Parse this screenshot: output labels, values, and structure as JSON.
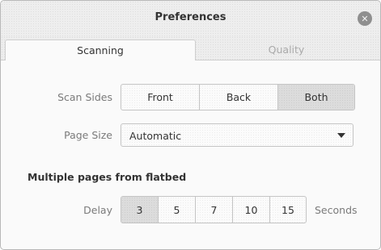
{
  "window": {
    "title": "Preferences",
    "close_icon": "close-icon"
  },
  "tabs": [
    {
      "label": "Scanning",
      "active": true
    },
    {
      "label": "Quality",
      "active": false
    }
  ],
  "scan_sides": {
    "label": "Scan Sides",
    "options": [
      "Front",
      "Back",
      "Both"
    ],
    "selected": "Both"
  },
  "page_size": {
    "label": "Page Size",
    "value": "Automatic"
  },
  "flatbed": {
    "heading": "Multiple pages from flatbed",
    "delay_label": "Delay",
    "options": [
      "3",
      "5",
      "7",
      "10",
      "15"
    ],
    "selected": "3",
    "unit_label": "Seconds"
  },
  "colors": {
    "selected_segment": "#dcdcdc",
    "border": "#c4c4c4",
    "close_button": "#8f8f8f"
  }
}
